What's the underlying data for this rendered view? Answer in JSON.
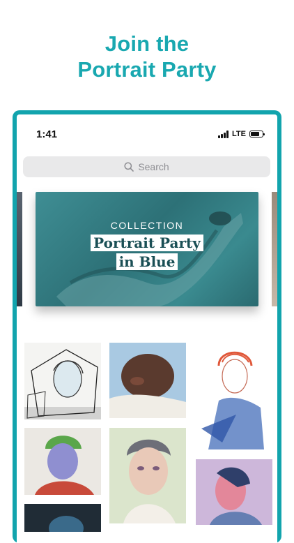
{
  "headline": {
    "line1": "Join the",
    "line2": "Portrait Party"
  },
  "colors": {
    "accent": "#19a8b0",
    "frame": "#12a4ad"
  },
  "status_bar": {
    "time": "1:41",
    "network": "LTE",
    "icons": [
      "signal-icon",
      "battery-icon"
    ]
  },
  "search": {
    "placeholder": "Search",
    "icon": "search-icon"
  },
  "featured": {
    "kicker": "COLLECTION",
    "title_line1": "Portrait Party",
    "title_line2": "in Blue"
  },
  "gallery": {
    "artworks": [
      "sketch-portrait",
      "sleeping-baby-painting",
      "red-haired-woman-drawing",
      "green-hair-portrait",
      "young-man-portrait",
      "blue-pink-watercolor-portrait",
      "dark-portrait-partial"
    ]
  }
}
